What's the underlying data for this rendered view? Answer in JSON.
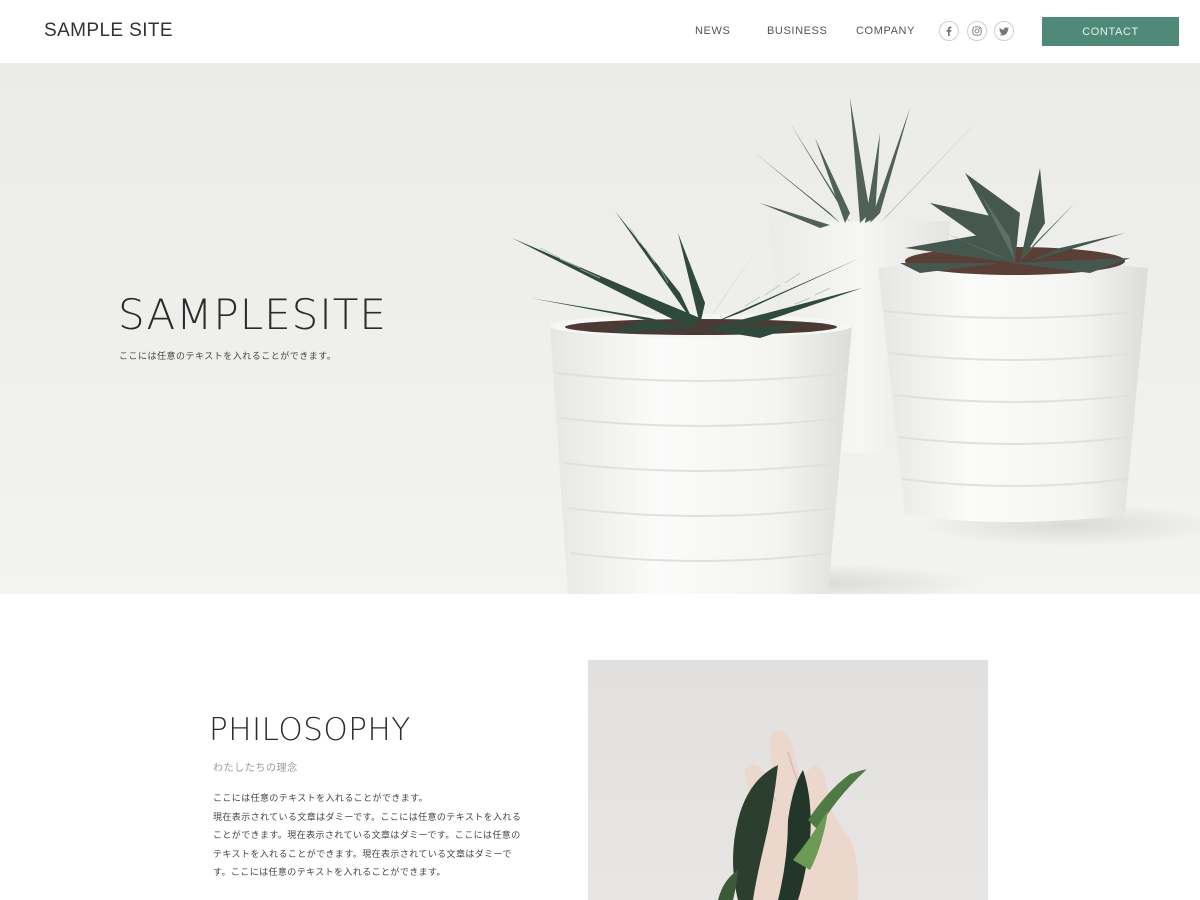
{
  "header": {
    "logo": "SAMPLE SITE",
    "nav": [
      {
        "label": "NEWS"
      },
      {
        "label": "BUSINESS"
      },
      {
        "label": "COMPANY"
      }
    ],
    "social_icons": [
      "facebook-icon",
      "instagram-icon",
      "twitter-icon"
    ],
    "contact_label": "CONTACT"
  },
  "hero": {
    "title": "SAMPLESITE",
    "subtitle": "ここには任意のテキストを入れることができます。"
  },
  "philosophy": {
    "title": "PHILOSOPHY",
    "subtitle": "わたしたちの理念",
    "body": "ここには任意のテキストを入れることができます。\n現在表示されている文章はダミーです。ここには任意のテキストを入れることができます。現在表示されている文章はダミーです。ここには任意のテキストを入れることができます。現在表示されている文章はダミーです。ここには任意のテキストを入れることができます。"
  },
  "colors": {
    "accent": "#4e8a77",
    "text": "#333333",
    "muted": "#999999"
  }
}
